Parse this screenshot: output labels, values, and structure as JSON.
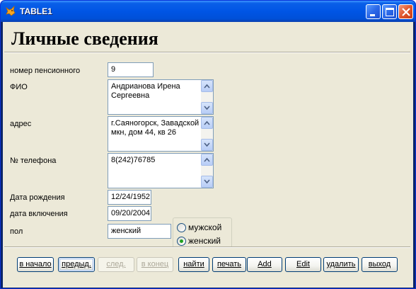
{
  "window": {
    "title": "TABLE1"
  },
  "form": {
    "heading": "Личные сведения",
    "fields": {
      "pension": {
        "label": "номер пенсионного",
        "value": "9"
      },
      "fio": {
        "label": "ФИО",
        "value": "Андрианова Ирена Сергеевна"
      },
      "address": {
        "label": "адрес",
        "value": "г.Саяногорск, Завадской мкн, дом 44, кв 26"
      },
      "phone": {
        "label": "№ телефона",
        "value": "8(242)76785"
      },
      "birth": {
        "label": "Дата рождения",
        "value": "12/24/1952"
      },
      "included": {
        "label": "дата включения",
        "value": "09/20/2004"
      },
      "gender": {
        "label": "пол",
        "value": "женский"
      }
    },
    "gender_options": [
      {
        "label": "мужской",
        "checked": false
      },
      {
        "label": "женский",
        "checked": true
      }
    ]
  },
  "buttons": {
    "first": "в начало",
    "prev": "предыд.",
    "next": "след.",
    "last": "в конец",
    "find": "найти",
    "print": "печать",
    "add": "Add",
    "edit": "Edit",
    "delete": "удалить",
    "exit": "выход"
  },
  "colors": {
    "titlebar": "#0055e5",
    "client_bg": "#ece9d8",
    "input_border": "#7f9db9"
  },
  "icons": {
    "app": "fox-icon",
    "minimize": "minimize-icon",
    "maximize": "maximize-icon",
    "close": "close-icon"
  }
}
